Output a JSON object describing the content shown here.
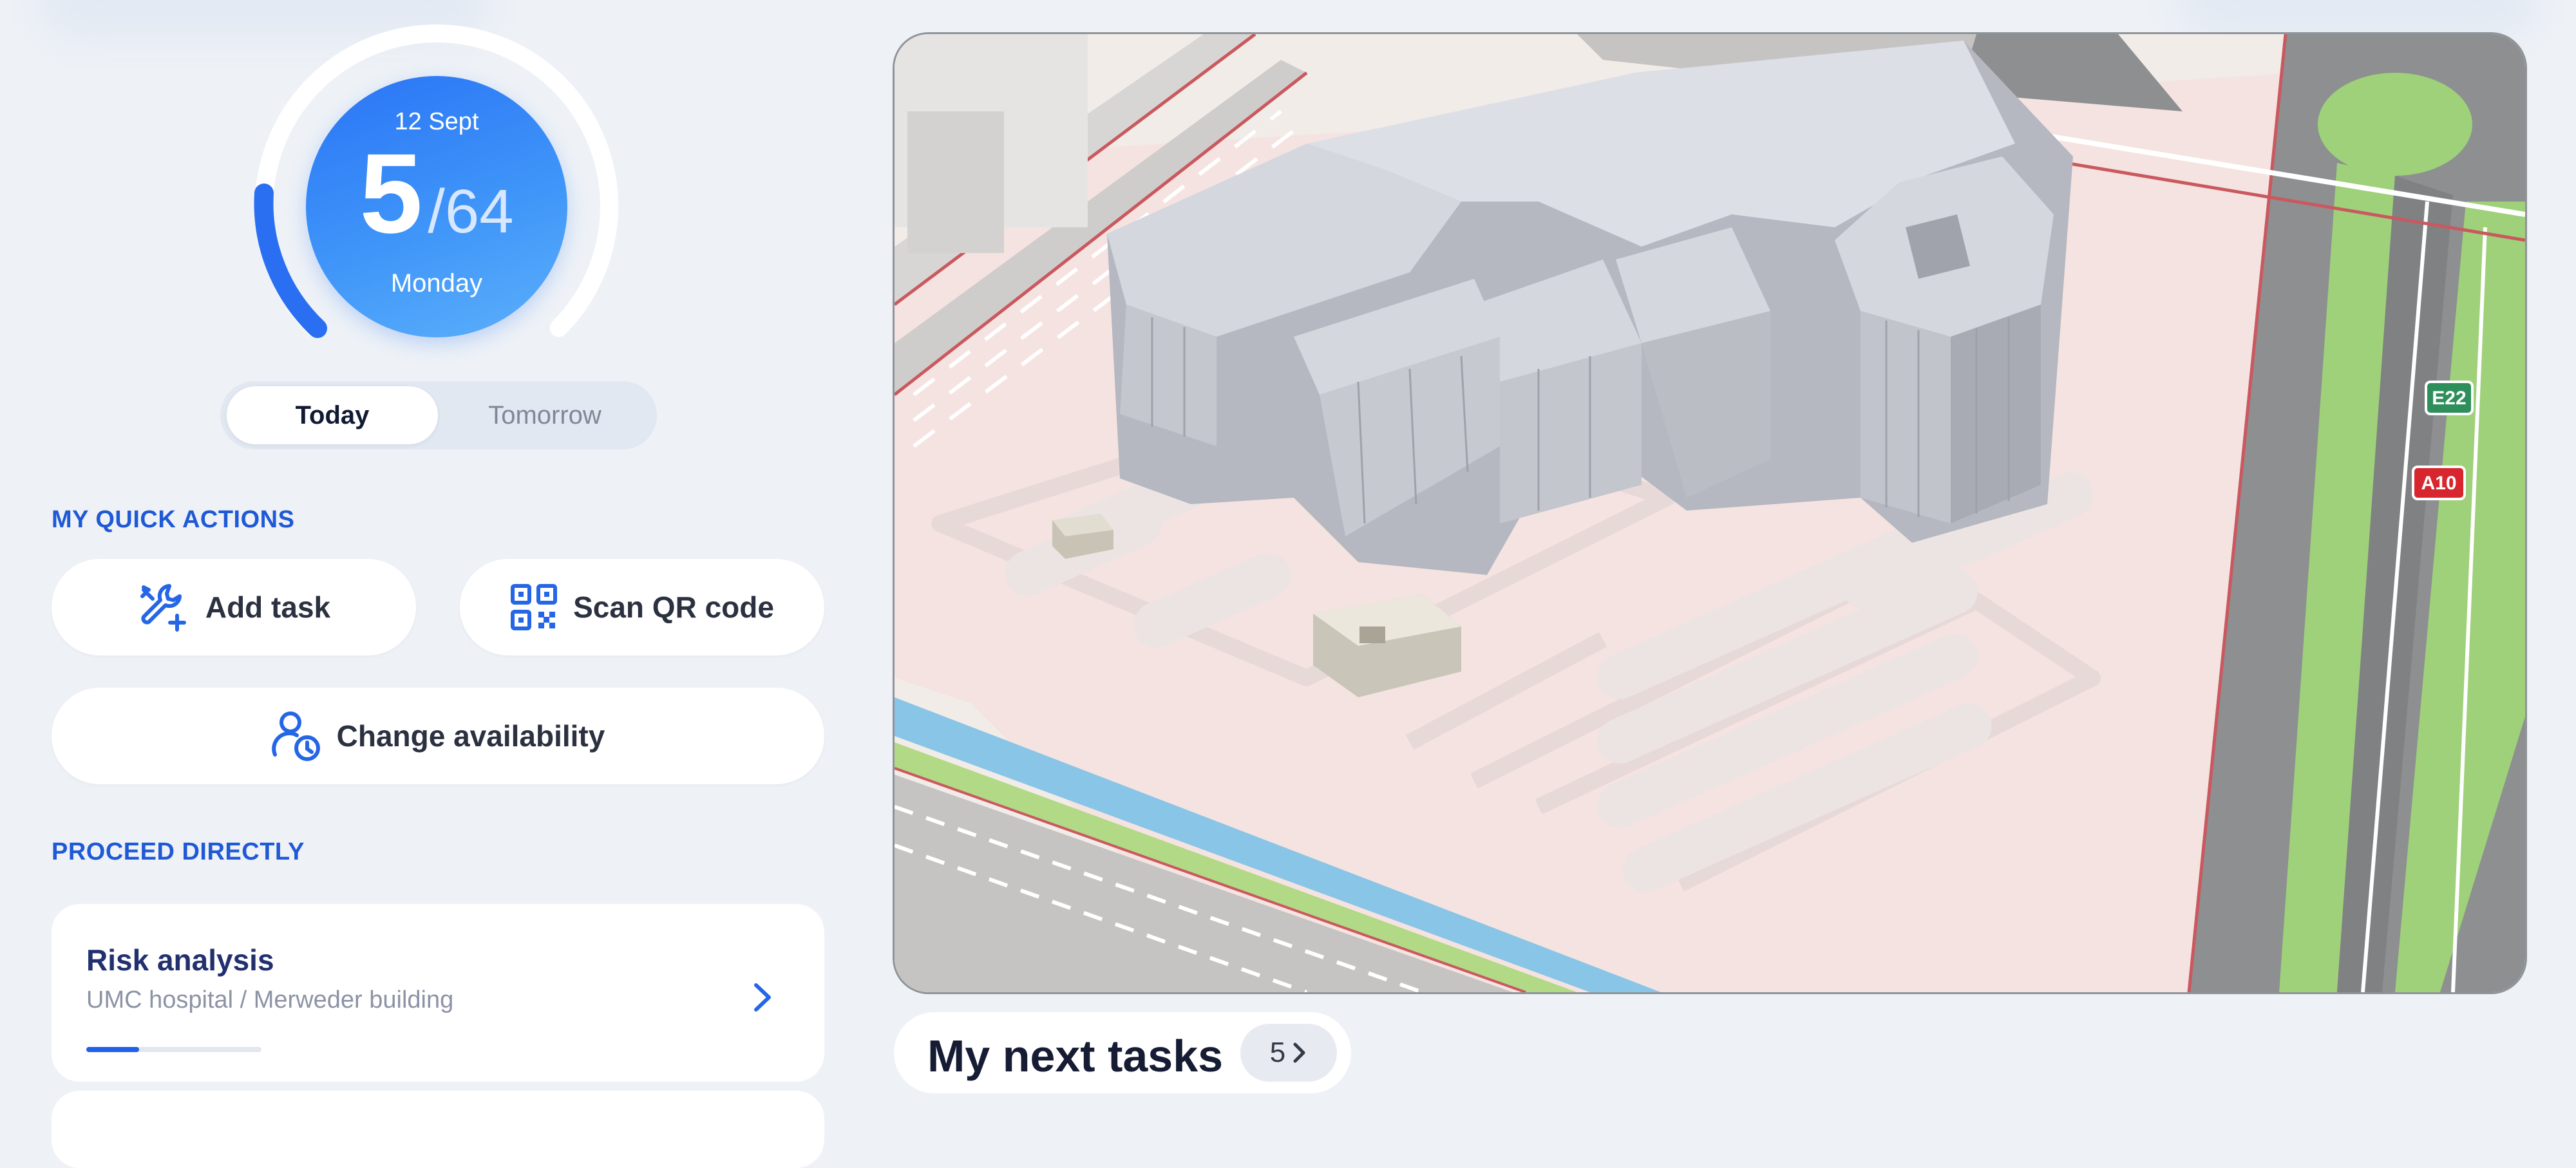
{
  "schedule": {
    "date": "12 Sept",
    "current": "5",
    "separator": "/",
    "total": "64",
    "weekday": "Monday",
    "progress_fraction": 0.08
  },
  "day_toggle": {
    "today": "Today",
    "tomorrow": "Tomorrow",
    "selected": "Today"
  },
  "quick_actions": {
    "heading": "MY QUICK ACTIONS",
    "add_task": "Add task",
    "scan_qr": "Scan QR code",
    "change_availability": "Change availability"
  },
  "proceed": {
    "heading": "PROCEED DIRECTLY",
    "card": {
      "title": "Risk analysis",
      "subtitle": "UMC hospital / Merweder building",
      "progress_fraction": 0.3
    }
  },
  "map": {
    "road_badges": [
      {
        "text": "E22",
        "color": "#2e8f5a"
      },
      {
        "text": "A10",
        "color": "#d7262e"
      }
    ]
  },
  "next_tasks": {
    "title": "My next tasks",
    "count": "5"
  },
  "colors": {
    "accent": "#1f59d6",
    "gauge_arc": "#2a6ff2",
    "background": "#eef2f7"
  }
}
